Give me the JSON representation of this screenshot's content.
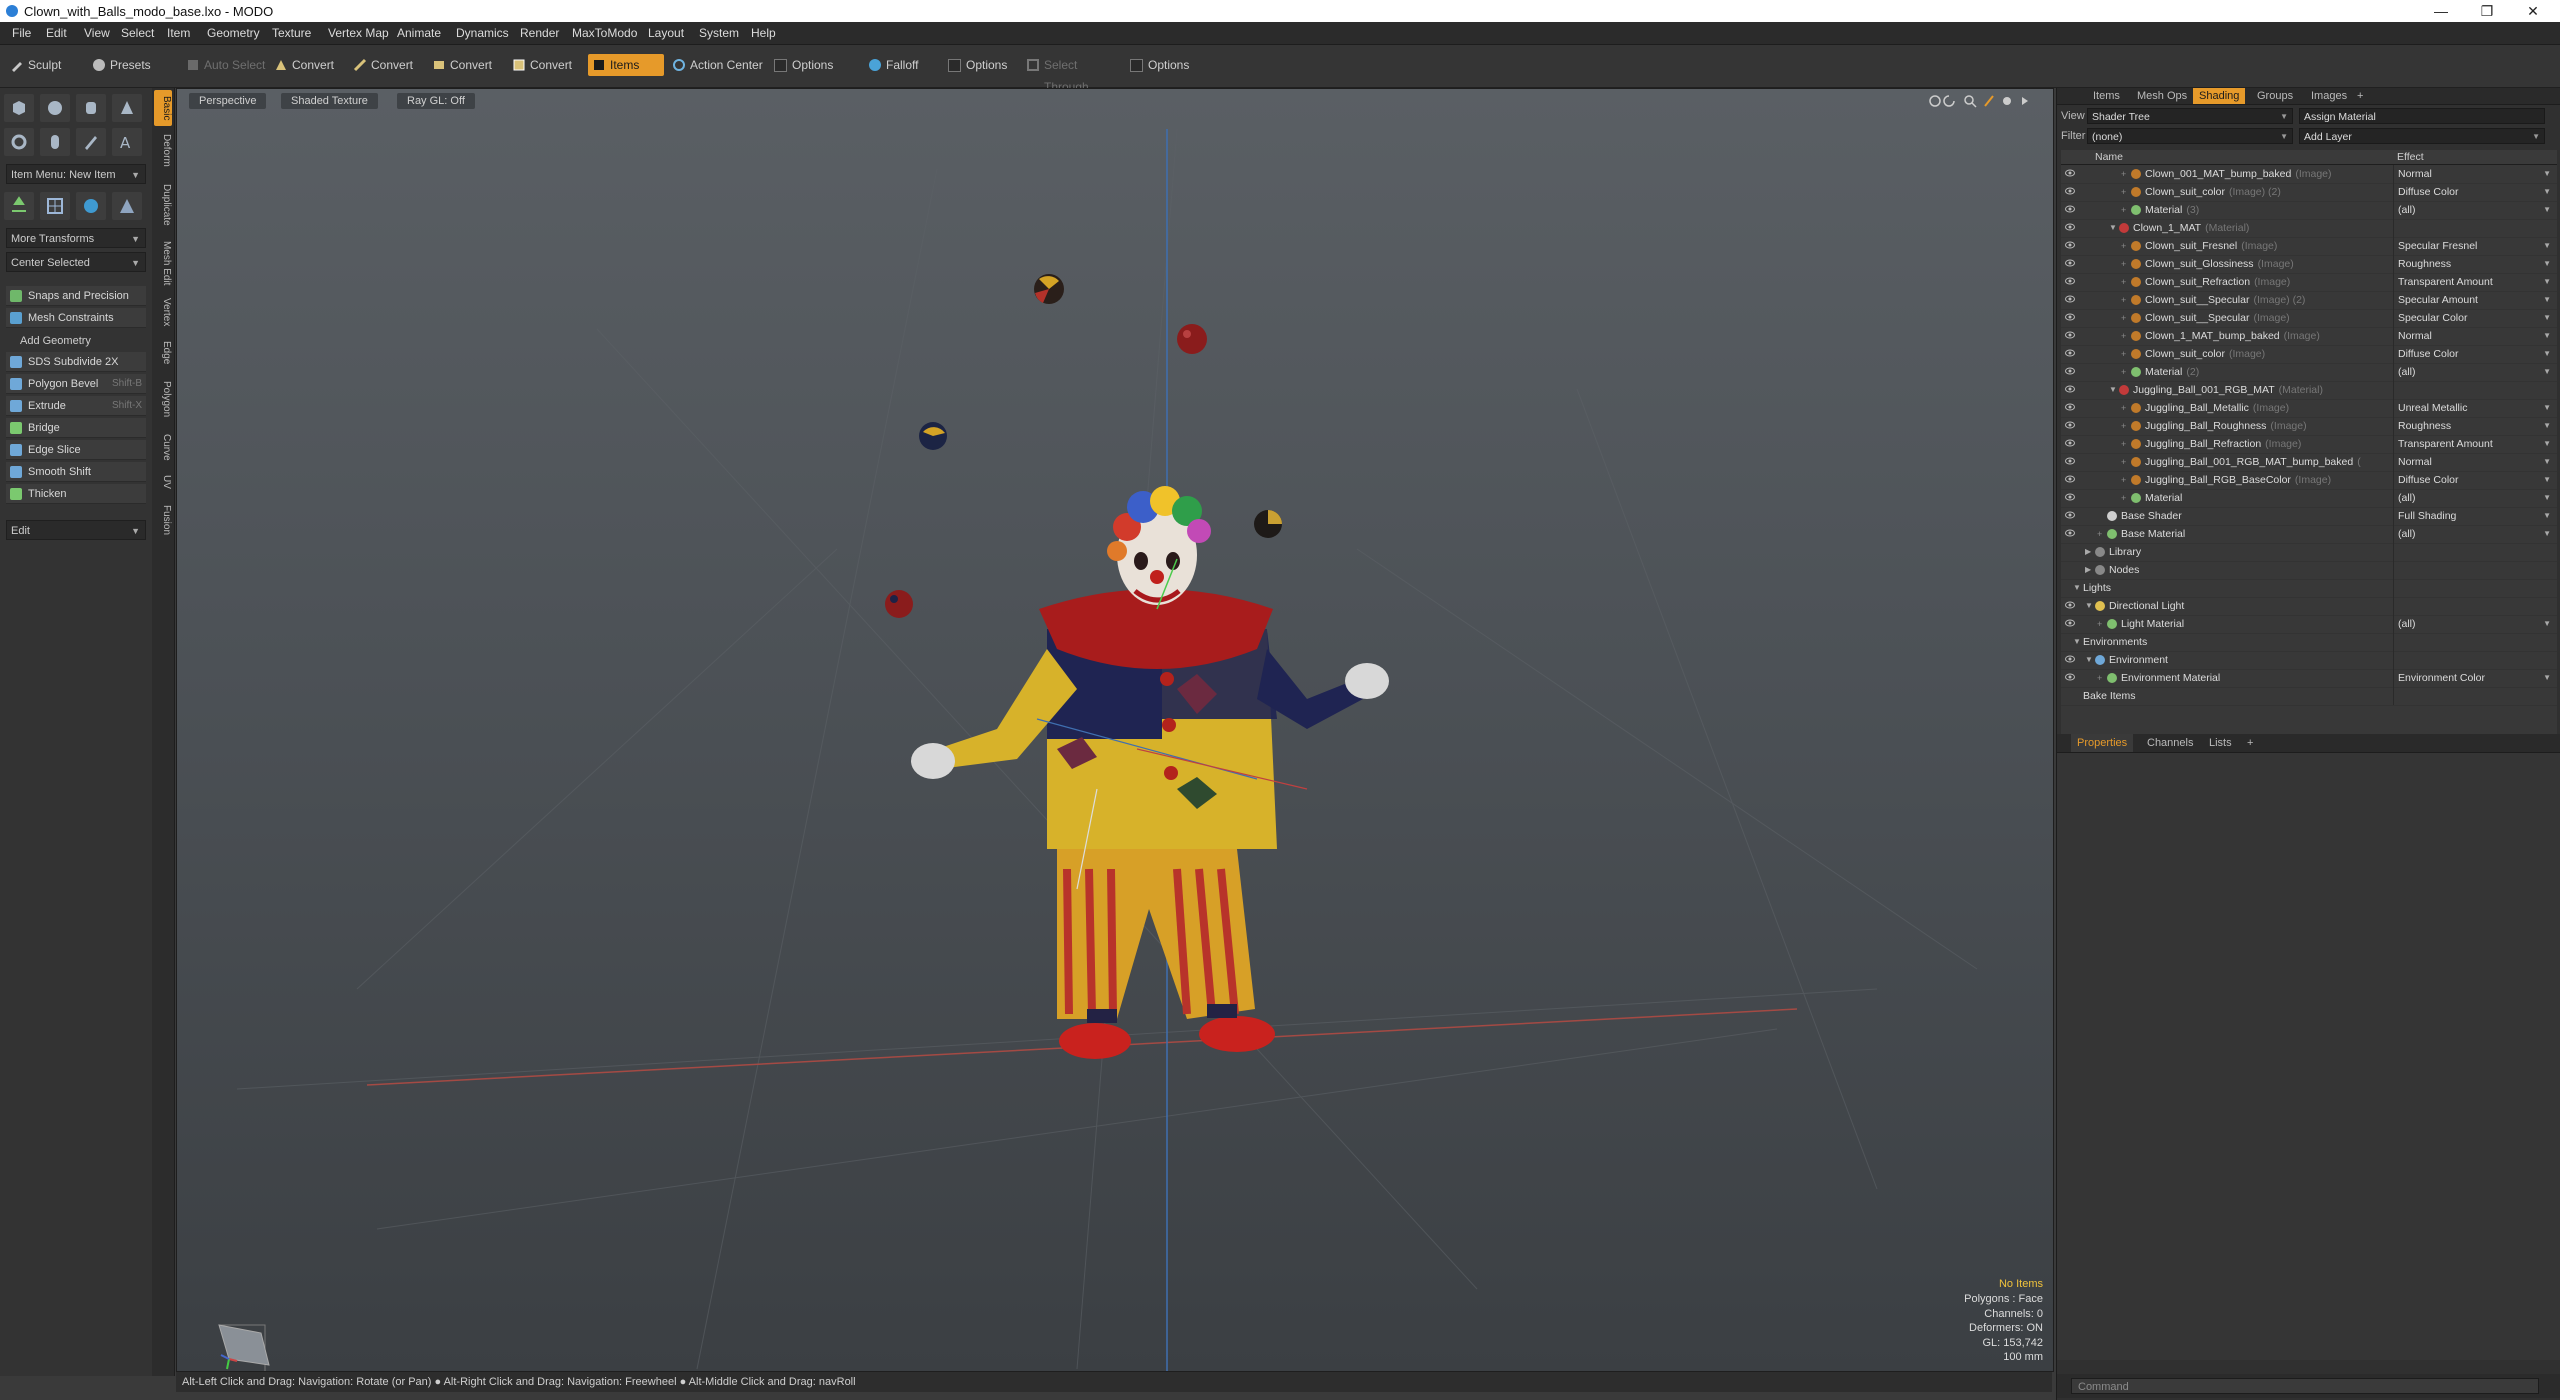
{
  "window": {
    "title": "Clown_with_Balls_modo_base.lxo - MODO",
    "minimize": "—",
    "maximize": "❐",
    "close": "✕"
  },
  "menu": [
    "File",
    "Edit",
    "View",
    "Select",
    "Item",
    "Geometry",
    "Texture",
    "Vertex Map",
    "Animate",
    "Dynamics",
    "Render",
    "MaxToModo",
    "Layout",
    "System",
    "Help"
  ],
  "toolbar": {
    "sculpt": "Sculpt",
    "presets": "Presets",
    "auto_select": "Auto Select",
    "convert": "Convert",
    "items": "Items",
    "action_center": "Action Center",
    "options": "Options",
    "falloff": "Falloff",
    "select_through": "Select Through"
  },
  "left_panel": {
    "vertical_tabs": [
      "Basic",
      "Deform",
      "Duplicate",
      "Mesh Edit",
      "Vertex",
      "Edge",
      "Polygon",
      "Curve",
      "UV",
      "Fusion"
    ],
    "item_menu": "Item Menu: New Item",
    "more_transforms": "More Transforms",
    "center_selected": "Center Selected",
    "snaps": "Snaps and Precision",
    "mesh_constraints": "Mesh Constraints",
    "add_geometry": "Add Geometry",
    "tools": [
      {
        "label": "SDS Subdivide 2X",
        "shortcut": ""
      },
      {
        "label": "Polygon Bevel",
        "shortcut": "Shift-B"
      },
      {
        "label": "Extrude",
        "shortcut": "Shift-X"
      },
      {
        "label": "Bridge",
        "shortcut": ""
      },
      {
        "label": "Edge Slice",
        "shortcut": ""
      },
      {
        "label": "Smooth Shift",
        "shortcut": ""
      },
      {
        "label": "Thicken",
        "shortcut": ""
      }
    ],
    "edit": "Edit"
  },
  "viewport": {
    "perspective": "Perspective",
    "shading": "Shaded Texture",
    "raygl": "Ray GL: Off",
    "hud": {
      "no_items": "No Items",
      "polygons": "Polygons : Face",
      "channels": "Channels: 0",
      "deformers": "Deformers: ON",
      "gl": "GL: 153,742",
      "grid": "100 mm"
    }
  },
  "status_bar": "Alt-Left Click and Drag: Navigation: Rotate (or Pan) ● Alt-Right Click and Drag: Navigation: Freewheel ● Alt-Middle Click and Drag: navRoll",
  "right_panel": {
    "tabs": [
      "Items",
      "Mesh Ops",
      "Shading",
      "Groups",
      "Images",
      "+"
    ],
    "view_label": "View",
    "view_value": "Shader Tree",
    "assign_material": "Assign Material",
    "filter_label": "Filter",
    "filter_value": "(none)",
    "add_layer": "Add Layer",
    "col_name": "Name",
    "col_effect": "Effect",
    "tree": [
      {
        "name": "Clown_001_MAT_bump_baked",
        "type": "(Image)",
        "effect": "Normal",
        "indent": 4,
        "kind": "image"
      },
      {
        "name": "Clown_suit_color",
        "type": "(Image) (2)",
        "effect": "Diffuse Color",
        "indent": 4,
        "kind": "image"
      },
      {
        "name": "Material",
        "type": "(3)",
        "effect": "(all)",
        "indent": 4,
        "kind": "mat"
      },
      {
        "name": "Clown_1_MAT",
        "type": "(Material)",
        "effect": "",
        "indent": 3,
        "kind": "group",
        "expanded": true
      },
      {
        "name": "Clown_suit_Fresnel",
        "type": "(Image)",
        "effect": "Specular Fresnel",
        "indent": 4,
        "kind": "image"
      },
      {
        "name": "Clown_suit_Glossiness",
        "type": "(Image)",
        "effect": "Roughness",
        "indent": 4,
        "kind": "image"
      },
      {
        "name": "Clown_suit_Refraction",
        "type": "(Image)",
        "effect": "Transparent Amount",
        "indent": 4,
        "kind": "image"
      },
      {
        "name": "Clown_suit__Specular",
        "type": "(Image) (2)",
        "effect": "Specular Amount",
        "indent": 4,
        "kind": "image"
      },
      {
        "name": "Clown_suit__Specular",
        "type": "(Image)",
        "effect": "Specular Color",
        "indent": 4,
        "kind": "image"
      },
      {
        "name": "Clown_1_MAT_bump_baked",
        "type": "(Image)",
        "effect": "Normal",
        "indent": 4,
        "kind": "image"
      },
      {
        "name": "Clown_suit_color",
        "type": "(Image)",
        "effect": "Diffuse Color",
        "indent": 4,
        "kind": "image"
      },
      {
        "name": "Material",
        "type": "(2)",
        "effect": "(all)",
        "indent": 4,
        "kind": "mat"
      },
      {
        "name": "Juggling_Ball_001_RGB_MAT",
        "type": "(Material)",
        "effect": "",
        "indent": 3,
        "kind": "group",
        "expanded": true
      },
      {
        "name": "Juggling_Ball_Metallic",
        "type": "(Image)",
        "effect": "Unreal Metallic",
        "indent": 4,
        "kind": "image"
      },
      {
        "name": "Juggling_Ball_Roughness",
        "type": "(Image)",
        "effect": "Roughness",
        "indent": 4,
        "kind": "image"
      },
      {
        "name": "Juggling_Ball_Refraction",
        "type": "(Image)",
        "effect": "Transparent Amount",
        "indent": 4,
        "kind": "image"
      },
      {
        "name": "Juggling_Ball_001_RGB_MAT_bump_baked",
        "type": "(",
        "effect": "Normal",
        "indent": 4,
        "kind": "image"
      },
      {
        "name": "Juggling_Ball_RGB_BaseColor",
        "type": "(Image)",
        "effect": "Diffuse Color",
        "indent": 4,
        "kind": "image"
      },
      {
        "name": "Material",
        "type": "",
        "effect": "(all)",
        "indent": 4,
        "kind": "mat"
      },
      {
        "name": "Base Shader",
        "type": "",
        "effect": "Full Shading",
        "indent": 2,
        "kind": "shader"
      },
      {
        "name": "Base Material",
        "type": "",
        "effect": "(all)",
        "indent": 2,
        "kind": "mat"
      },
      {
        "name": "Library",
        "type": "",
        "effect": "",
        "indent": 1,
        "kind": "folder",
        "collapsed": true
      },
      {
        "name": "Nodes",
        "type": "",
        "effect": "",
        "indent": 1,
        "kind": "folder",
        "collapsed": true
      },
      {
        "name": "Lights",
        "type": "",
        "effect": "",
        "indent": 0,
        "kind": "section",
        "expanded": true
      },
      {
        "name": "Directional Light",
        "type": "",
        "effect": "",
        "indent": 1,
        "kind": "light",
        "expanded": true
      },
      {
        "name": "Light Material",
        "type": "",
        "effect": "(all)",
        "indent": 2,
        "kind": "mat"
      },
      {
        "name": "Environments",
        "type": "",
        "effect": "",
        "indent": 0,
        "kind": "section",
        "expanded": true
      },
      {
        "name": "Environment",
        "type": "",
        "effect": "",
        "indent": 1,
        "kind": "env",
        "expanded": true
      },
      {
        "name": "Environment Material",
        "type": "",
        "effect": "Environment Color",
        "indent": 2,
        "kind": "mat"
      },
      {
        "name": "Bake Items",
        "type": "",
        "effect": "",
        "indent": 0,
        "kind": "section"
      }
    ],
    "lower_tabs": [
      "Properties",
      "Channels",
      "Lists",
      "+"
    ],
    "command_placeholder": "Command"
  },
  "colors": {
    "accent": "#e69a2a",
    "ui_bg": "#333333",
    "viewport_top": "#5a5f64"
  }
}
